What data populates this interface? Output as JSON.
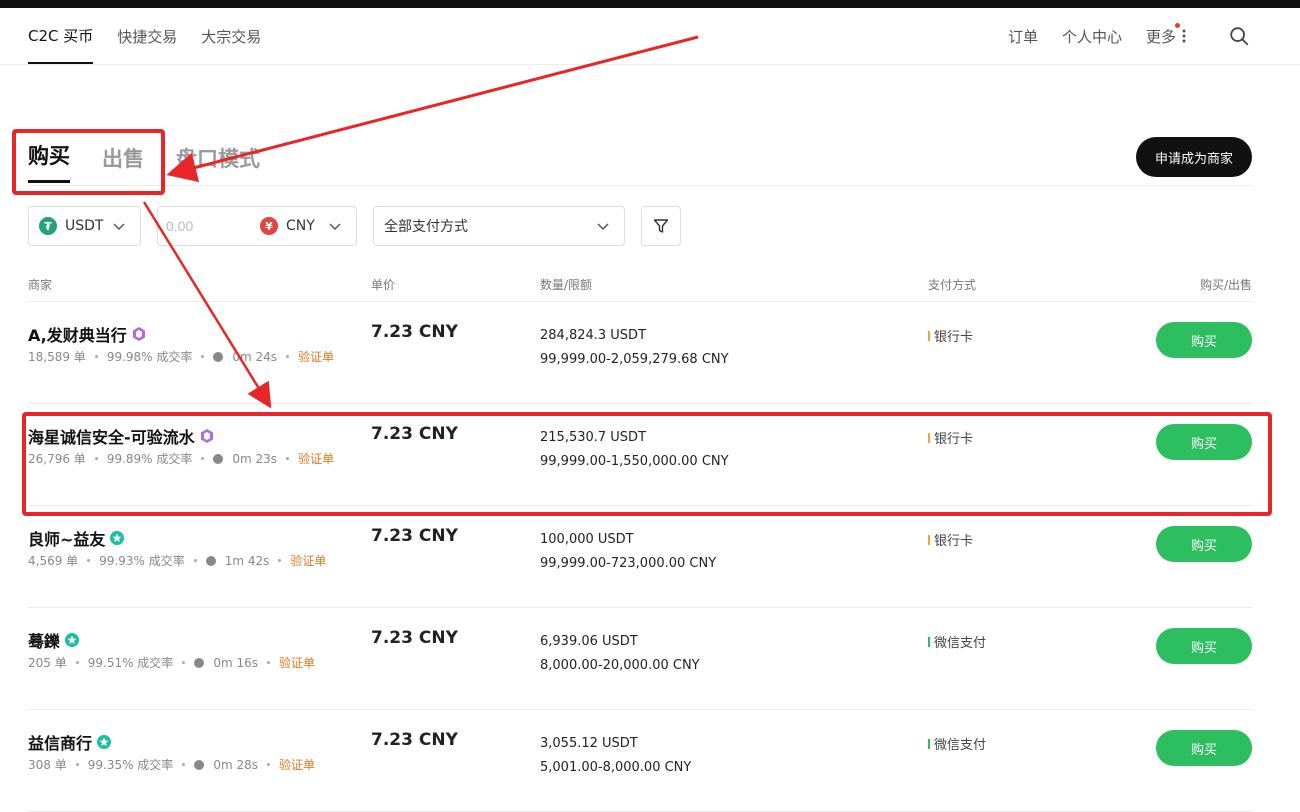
{
  "nav": {
    "tabs": [
      "C2C 买币",
      "快捷交易",
      "大宗交易"
    ],
    "links": [
      "订单",
      "个人中心",
      "更多"
    ]
  },
  "mode": {
    "tabs": [
      "购买",
      "出售",
      "盘口模式"
    ],
    "merchant_button": "申请成为商家"
  },
  "filters": {
    "coin": "USDT",
    "coin_icon": "tether-icon",
    "amount_placeholder": "0.00",
    "fiat": "CNY",
    "fiat_icon": "yuan-icon",
    "payment": "全部支付方式"
  },
  "table": {
    "headers": [
      "商家",
      "单价",
      "数量/限额",
      "支付方式",
      "购买/出售"
    ],
    "rows": [
      {
        "name": "A,发财典当行",
        "badge": "purple",
        "orders": "18,589 单",
        "rate": "99.98% 成交率",
        "time": "0m 24s",
        "verify": "验证单",
        "price": "7.23 CNY",
        "qty": "284,824.3 USDT",
        "limit": "99,999.00-2,059,279.68 CNY",
        "pay": "银行卡",
        "pay_color": "#f0a33a",
        "action": "购买"
      },
      {
        "name": "海星诚信安全-可验流水",
        "badge": "purple",
        "orders": "26,796 单",
        "rate": "99.89% 成交率",
        "time": "0m 23s",
        "verify": "验证单",
        "price": "7.23 CNY",
        "qty": "215,530.7 USDT",
        "limit": "99,999.00-1,550,000.00 CNY",
        "pay": "银行卡",
        "pay_color": "#f0a33a",
        "action": "购买"
      },
      {
        "name": "良师~益友",
        "badge": "teal",
        "orders": "4,569 单",
        "rate": "99.93% 成交率",
        "time": "1m 42s",
        "verify": "验证单",
        "price": "7.23 CNY",
        "qty": "100,000 USDT",
        "limit": "99,999.00-723,000.00 CNY",
        "pay": "银行卡",
        "pay_color": "#f0a33a",
        "action": "购买"
      },
      {
        "name": "蓦鑠",
        "badge": "teal",
        "orders": "205 单",
        "rate": "99.51% 成交率",
        "time": "0m 16s",
        "verify": "验证单",
        "price": "7.23 CNY",
        "qty": "6,939.06 USDT",
        "limit": "8,000.00-20,000.00 CNY",
        "pay": "微信支付",
        "pay_color": "#2dbe60",
        "action": "购买"
      },
      {
        "name": "益信商行",
        "badge": "teal",
        "orders": "308 单",
        "rate": "99.35% 成交率",
        "time": "0m 28s",
        "verify": "验证单",
        "price": "7.23 CNY",
        "qty": "3,055.12 USDT",
        "limit": "5,001.00-8,000.00 CNY",
        "pay": "微信支付",
        "pay_color": "#2dbe60",
        "action": "购买"
      }
    ]
  },
  "colors": {
    "buy_green": "#2dbe60",
    "annotation_red": "#e8262a",
    "verify_orange": "#e07a1f"
  }
}
